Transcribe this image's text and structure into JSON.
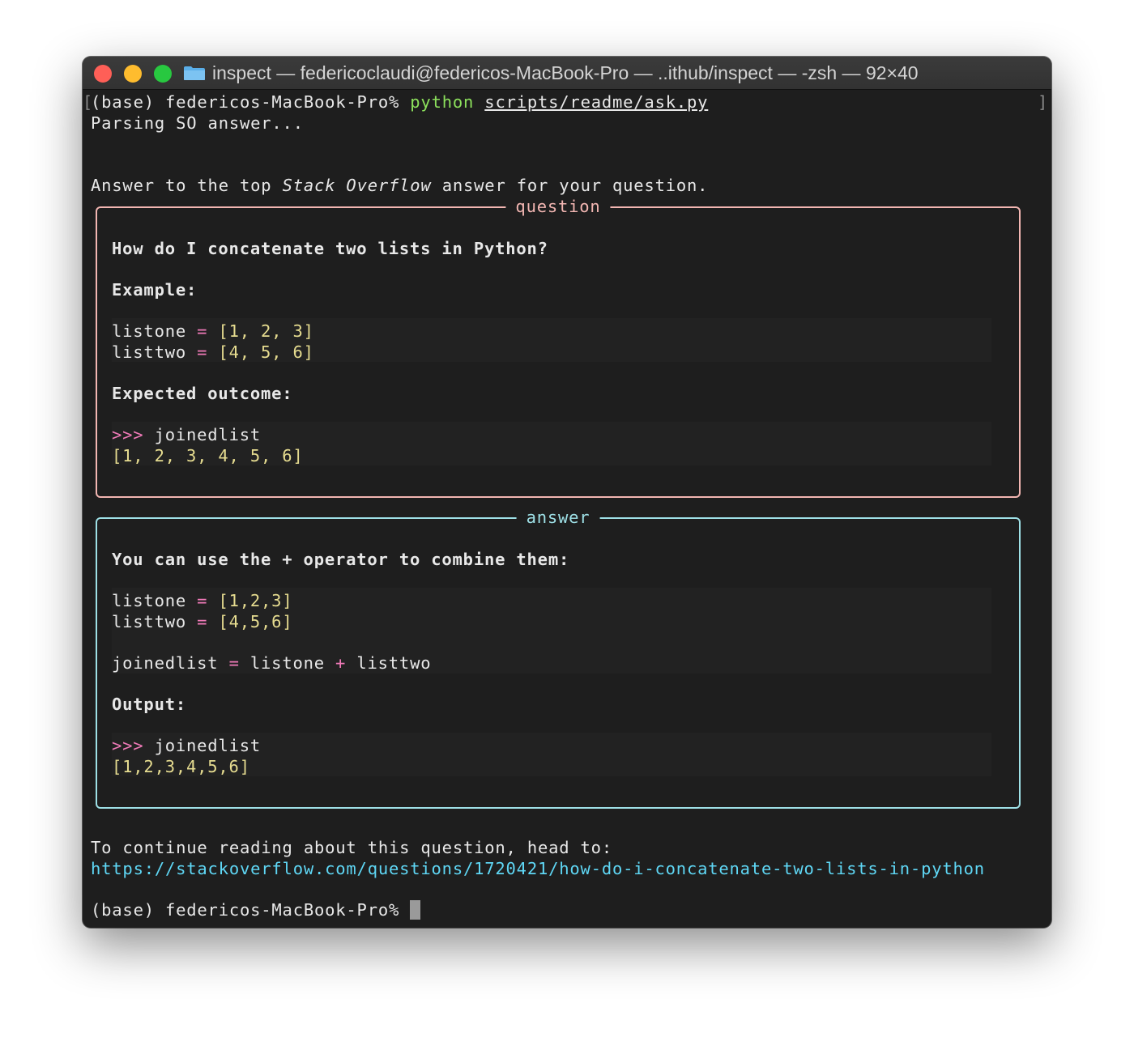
{
  "window": {
    "title": "inspect — federicoclaudi@federicos-MacBook-Pro — ..ithub/inspect — -zsh — 92×40"
  },
  "terminal": {
    "prompt": "(base) federicos-MacBook-Pro%",
    "command": "python",
    "script_path": "scripts/readme/ask.py",
    "parsing": "Parsing SO answer...",
    "intro_before": "Answer to the top",
    "intro_italic": "Stack Overflow",
    "intro_after": "answer for your question.",
    "question_panel": {
      "title": "question",
      "heading": "How do I concatenate two lists in Python?",
      "example_label": "Example:",
      "code1_line1": {
        "name": "listone",
        "op": "=",
        "values": "[1, 2, 3]"
      },
      "code1_line2": {
        "name": "listtwo",
        "op": "=",
        "values": "[4, 5, 6]"
      },
      "expected_label": "Expected outcome:",
      "repl_prompt": ">>>",
      "repl_command": "joinedlist",
      "repl_output": "[1, 2, 3, 4, 5, 6]"
    },
    "answer_panel": {
      "title": "answer",
      "heading": "You can use the + operator to combine them:",
      "code1_line1": {
        "name": "listone",
        "op": "=",
        "values": "[1,2,3]"
      },
      "code1_line2": {
        "name": "listtwo",
        "op": "=",
        "values": "[4,5,6]"
      },
      "code1_line3": {
        "lhs": "joinedlist",
        "op": "=",
        "a": "listone",
        "plus": "+",
        "b": "listtwo"
      },
      "output_label": "Output:",
      "repl_prompt": ">>>",
      "repl_command": "joinedlist",
      "repl_output": "[1,2,3,4,5,6]"
    },
    "continue_text": "To continue reading about this question, head to:",
    "url": "https://stackoverflow.com/questions/1720421/how-do-i-concatenate-two-lists-in-python",
    "final_prompt": "(base) federicos-MacBook-Pro%"
  },
  "icons": {
    "close": "close-light",
    "minimize": "minimize-light",
    "zoom": "zoom-light",
    "folder": "folder-icon"
  }
}
